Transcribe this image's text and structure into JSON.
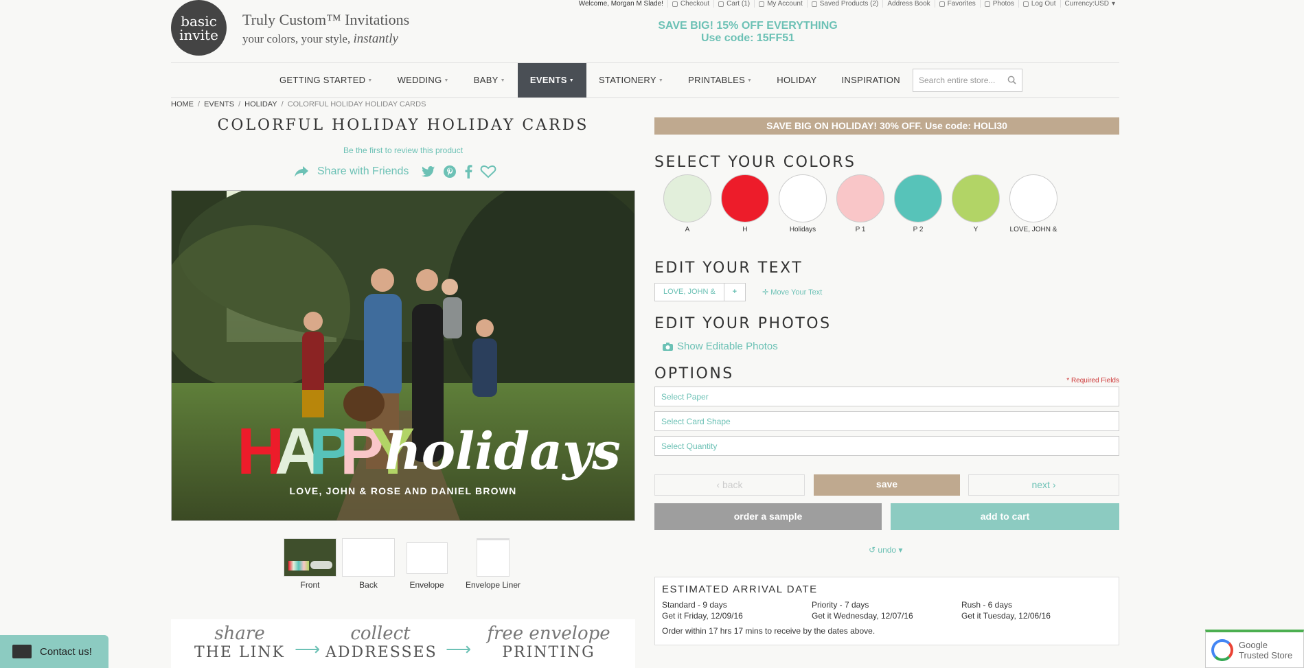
{
  "toplinks": [
    "Welcome, Morgan M Slade!",
    "Checkout",
    "Cart (1)",
    "My Account",
    "Saved Products (2)",
    "Address Book",
    "Favorites",
    "Photos",
    "Log Out",
    "Currency:USD"
  ],
  "header": {
    "logo_line1": "basic",
    "logo_line2": "invite",
    "tagline1": "Truly Custom™ Invitations",
    "tagline2": "your colors, your style,",
    "tagline2_italic": "instantly",
    "promo_line1": "SAVE BIG! 15% OFF EVERYTHING",
    "promo_line2": "Use code: 15FF51"
  },
  "nav": {
    "items": [
      "GETTING STARTED",
      "WEDDING",
      "BABY",
      "EVENTS",
      "STATIONERY",
      "PRINTABLES",
      "HOLIDAY",
      "INSPIRATION"
    ],
    "search_placeholder": "Search entire store..."
  },
  "breadcrumb": [
    "HOME",
    "EVENTS",
    "HOLIDAY",
    "COLORFUL HOLIDAY HOLIDAY CARDS"
  ],
  "product": {
    "title": "COLORFUL HOLIDAY HOLIDAY CARDS",
    "review_link": "Be the first to review this product",
    "share_label": "Share with Friends",
    "card_happy": [
      "H",
      "A",
      "P",
      "P",
      "Y"
    ],
    "card_holidays": "holidays",
    "card_names": "LOVE, JOHN & ROSE AND DANIEL BROWN",
    "thumbs": [
      "Front",
      "Back",
      "Envelope",
      "Envelope Liner"
    ]
  },
  "promo_banner": {
    "items": [
      {
        "hand": "share",
        "big": "THE LINK"
      },
      {
        "hand": "collect",
        "big": "ADDRESSES"
      },
      {
        "hand": "free envelope",
        "big": "PRINTING"
      }
    ]
  },
  "right": {
    "sale_banner": "SAVE BIG ON HOLIDAY! 30% OFF. Use code: HOLI30",
    "select_colors": "SELECT YOUR COLORS",
    "swatches": [
      {
        "label": "A",
        "color": "#e2efdb"
      },
      {
        "label": "H",
        "color": "#ed1c2a"
      },
      {
        "label": "Holidays",
        "color": "#ffffff"
      },
      {
        "label": "P 1",
        "color": "#f9c6c8"
      },
      {
        "label": "P 2",
        "color": "#57c3b9"
      },
      {
        "label": "Y",
        "color": "#b2d466"
      },
      {
        "label": "LOVE, JOHN &",
        "color": "#ffffff"
      }
    ],
    "edit_text": "EDIT YOUR TEXT",
    "text_field": "LOVE, JOHN &",
    "text_add": "+",
    "move_text": "Move Your Text",
    "edit_photos": "EDIT YOUR PHOTOS",
    "show_photos": "Show Editable Photos",
    "options": "OPTIONS",
    "required": "* Required Fields",
    "selects": [
      "Select Paper",
      "Select Card Shape",
      "Select Quantity"
    ],
    "back": "back",
    "save": "save",
    "next": "next",
    "order_sample": "order a sample",
    "add_to_cart": "add to cart",
    "undo": "undo",
    "arrival": {
      "title": "ESTIMATED ARRIVAL DATE",
      "cols": [
        {
          "name": "Standard - 9 days",
          "date": "Get it Friday, 12/09/16"
        },
        {
          "name": "Priority - 7 days",
          "date": "Get it Wednesday, 12/07/16"
        },
        {
          "name": "Rush - 6 days",
          "date": "Get it Tuesday, 12/06/16"
        }
      ],
      "note": "Order within 17 hrs 17 mins to receive by the dates above."
    }
  },
  "contact": "Contact us!",
  "trusted": {
    "line1": "Google",
    "line2": "Trusted Store"
  },
  "colors": {
    "accent": "#6cc1b5",
    "tan": "#bfa98f",
    "nav_active": "#4a4f55"
  }
}
